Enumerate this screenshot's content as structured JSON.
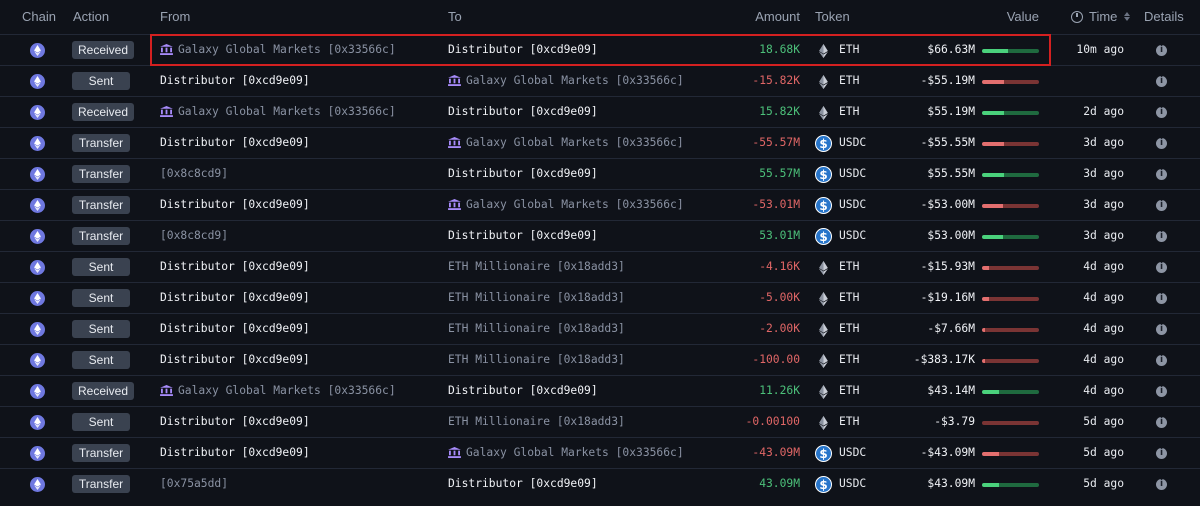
{
  "header": {
    "chain": "Chain",
    "action": "Action",
    "from": "From",
    "to": "To",
    "amount": "Amount",
    "token": "Token",
    "value": "Value",
    "time": "Time",
    "details": "Details"
  },
  "colors": {
    "background": "#0f1219",
    "positive": "#4cc07a",
    "negative": "#e06666",
    "highlight": "#d42020",
    "eth_chain": "#6f78e0",
    "usdc": "#2775ca"
  },
  "rows": [
    {
      "action": "Received",
      "from": "Galaxy Global Markets [0x33566c]",
      "from_entity": true,
      "to": "Distributor [0xcd9e09]",
      "to_entity": false,
      "amount": "18.68K",
      "dir": "in",
      "token": "ETH",
      "value": "$66.63M",
      "bar": 0.45,
      "time": "10m ago",
      "highlighted": true
    },
    {
      "action": "Sent",
      "from": "Distributor [0xcd9e09]",
      "from_entity": false,
      "to": "Galaxy Global Markets [0x33566c]",
      "to_entity": true,
      "amount": "-15.82K",
      "dir": "out",
      "token": "ETH",
      "value": "-$55.19M",
      "bar": 0.38
    },
    {
      "action": "Received",
      "from": "Galaxy Global Markets [0x33566c]",
      "from_entity": true,
      "to": "Distributor [0xcd9e09]",
      "to_entity": false,
      "amount": "15.82K",
      "dir": "in",
      "token": "ETH",
      "value": "$55.19M",
      "bar": 0.38,
      "time": "2d ago"
    },
    {
      "action": "Transfer",
      "from": "Distributor [0xcd9e09]",
      "from_entity": false,
      "to": "Galaxy Global Markets [0x33566c]",
      "to_entity": true,
      "amount": "-55.57M",
      "dir": "out",
      "token": "USDC",
      "value": "-$55.55M",
      "bar": 0.38,
      "time": "3d ago"
    },
    {
      "action": "Transfer",
      "from": "[0x8c8cd9]",
      "from_entity": false,
      "to": "Distributor [0xcd9e09]",
      "to_entity": false,
      "amount": "55.57M",
      "dir": "in",
      "token": "USDC",
      "value": "$55.55M",
      "bar": 0.38,
      "time": "3d ago"
    },
    {
      "action": "Transfer",
      "from": "Distributor [0xcd9e09]",
      "from_entity": false,
      "to": "Galaxy Global Markets [0x33566c]",
      "to_entity": true,
      "amount": "-53.01M",
      "dir": "out",
      "token": "USDC",
      "value": "-$53.00M",
      "bar": 0.36,
      "time": "3d ago"
    },
    {
      "action": "Transfer",
      "from": "[0x8c8cd9]",
      "from_entity": false,
      "to": "Distributor [0xcd9e09]",
      "to_entity": false,
      "amount": "53.01M",
      "dir": "in",
      "token": "USDC",
      "value": "$53.00M",
      "bar": 0.36,
      "time": "3d ago"
    },
    {
      "action": "Sent",
      "from": "Distributor [0xcd9e09]",
      "from_entity": false,
      "to": "ETH Millionaire [0x18add3]",
      "to_entity": false,
      "to_dim": true,
      "amount": "-4.16K",
      "dir": "out",
      "token": "ETH",
      "value": "-$15.93M",
      "bar": 0.12,
      "time": "4d ago"
    },
    {
      "action": "Sent",
      "from": "Distributor [0xcd9e09]",
      "from_entity": false,
      "to": "ETH Millionaire [0x18add3]",
      "to_entity": false,
      "to_dim": true,
      "amount": "-5.00K",
      "dir": "out",
      "token": "ETH",
      "value": "-$19.16M",
      "bar": 0.13,
      "time": "4d ago"
    },
    {
      "action": "Sent",
      "from": "Distributor [0xcd9e09]",
      "from_entity": false,
      "to": "ETH Millionaire [0x18add3]",
      "to_entity": false,
      "to_dim": true,
      "amount": "-2.00K",
      "dir": "out",
      "token": "ETH",
      "value": "-$7.66M",
      "bar": 0.06,
      "time": "4d ago"
    },
    {
      "action": "Sent",
      "from": "Distributor [0xcd9e09]",
      "from_entity": false,
      "to": "ETH Millionaire [0x18add3]",
      "to_entity": false,
      "to_dim": true,
      "amount": "-100.00",
      "dir": "out",
      "token": "ETH",
      "value": "-$383.17K",
      "bar": 0.02,
      "time": "4d ago"
    },
    {
      "action": "Received",
      "from": "Galaxy Global Markets [0x33566c]",
      "from_entity": true,
      "to": "Distributor [0xcd9e09]",
      "to_entity": false,
      "amount": "11.26K",
      "dir": "in",
      "token": "ETH",
      "value": "$43.14M",
      "bar": 0.29,
      "time": "4d ago"
    },
    {
      "action": "Sent",
      "from": "Distributor [0xcd9e09]",
      "from_entity": false,
      "to": "ETH Millionaire [0x18add3]",
      "to_entity": false,
      "to_dim": true,
      "amount": "-0.00100",
      "dir": "out",
      "token": "ETH",
      "value": "-$3.79",
      "bar": 0.0,
      "time": "5d ago"
    },
    {
      "action": "Transfer",
      "from": "Distributor [0xcd9e09]",
      "from_entity": false,
      "to": "Galaxy Global Markets [0x33566c]",
      "to_entity": true,
      "amount": "-43.09M",
      "dir": "out",
      "token": "USDC",
      "value": "-$43.09M",
      "bar": 0.29,
      "time": "5d ago"
    },
    {
      "action": "Transfer",
      "from": "[0x75a5dd]",
      "from_entity": false,
      "to": "Distributor [0xcd9e09]",
      "to_entity": false,
      "amount": "43.09M",
      "dir": "in",
      "token": "USDC",
      "value": "$43.09M",
      "bar": 0.29,
      "time": "5d ago"
    }
  ]
}
